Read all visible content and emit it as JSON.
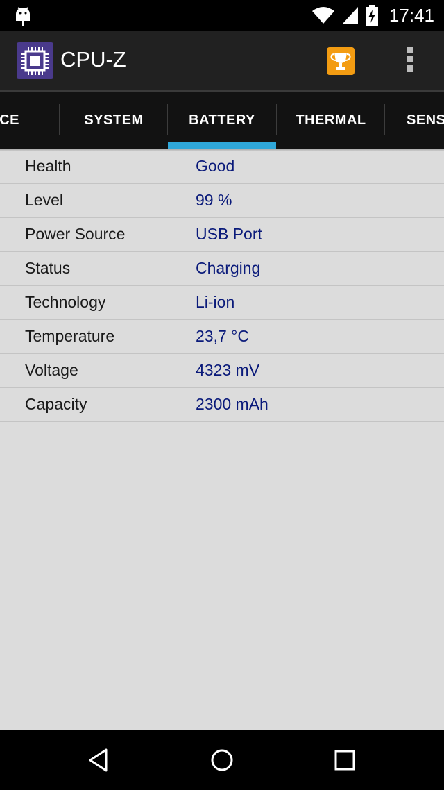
{
  "status_bar": {
    "time": "17:41",
    "icons": [
      "android-debug-icon",
      "wifi-icon",
      "signal-icon",
      "battery-charging-icon"
    ]
  },
  "app_bar": {
    "title": "CPU-Z",
    "icons": [
      "app-logo-icon",
      "trophy-icon",
      "overflow-menu-icon"
    ]
  },
  "tabs": {
    "items": [
      {
        "label": "VICE"
      },
      {
        "label": "SYSTEM"
      },
      {
        "label": "BATTERY"
      },
      {
        "label": "THERMAL"
      },
      {
        "label": "SENSO"
      }
    ],
    "selected": "BATTERY",
    "accent_color": "#2fa7d9"
  },
  "battery": {
    "rows": [
      {
        "label": "Health",
        "value": "Good"
      },
      {
        "label": "Level",
        "value": "99 %"
      },
      {
        "label": "Power Source",
        "value": "USB Port"
      },
      {
        "label": "Status",
        "value": "Charging"
      },
      {
        "label": "Technology",
        "value": "Li-ion"
      },
      {
        "label": "Temperature",
        "value": "23,7 °C"
      },
      {
        "label": "Voltage",
        "value": "4323 mV"
      },
      {
        "label": "Capacity",
        "value": "2300 mAh"
      }
    ]
  },
  "nav_bar": {
    "icons": [
      "back-icon",
      "home-icon",
      "recents-icon"
    ]
  },
  "colors": {
    "value_text": "#0a1a7a",
    "background": "#dcdcdc",
    "app_bar": "#212121",
    "trophy": "#f39c12"
  }
}
